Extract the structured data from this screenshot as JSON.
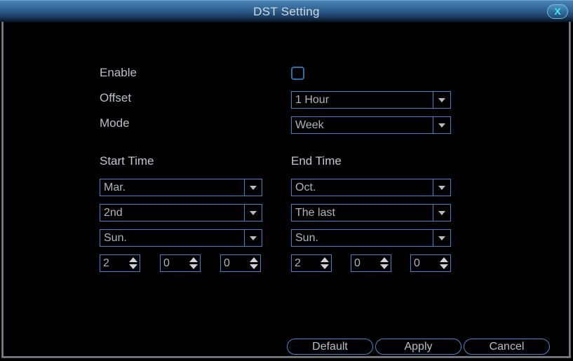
{
  "window": {
    "title": "DST Setting",
    "close_icon": "close-icon",
    "close_glyph": "X"
  },
  "colors": {
    "accent_border": "#3f83c8",
    "title_gradient_top": "#4a82b4",
    "title_gradient_bottom": "#050a12",
    "text": "#b9bfc6",
    "close_x": "#49e8ef",
    "background": "#000000"
  },
  "form": {
    "enable": {
      "label": "Enable",
      "checked": false
    },
    "offset": {
      "label": "Offset",
      "value": "1 Hour"
    },
    "mode": {
      "label": "Mode",
      "value": "Week"
    }
  },
  "start_time": {
    "heading": "Start Time",
    "month": "Mar.",
    "week": "2nd",
    "weekday": "Sun.",
    "hour": "2",
    "minute": "0",
    "second": "0"
  },
  "end_time": {
    "heading": "End Time",
    "month": "Oct.",
    "week": "The last",
    "weekday": "Sun.",
    "hour": "2",
    "minute": "0",
    "second": "0"
  },
  "buttons": {
    "default": "Default",
    "apply": "Apply",
    "cancel": "Cancel"
  }
}
